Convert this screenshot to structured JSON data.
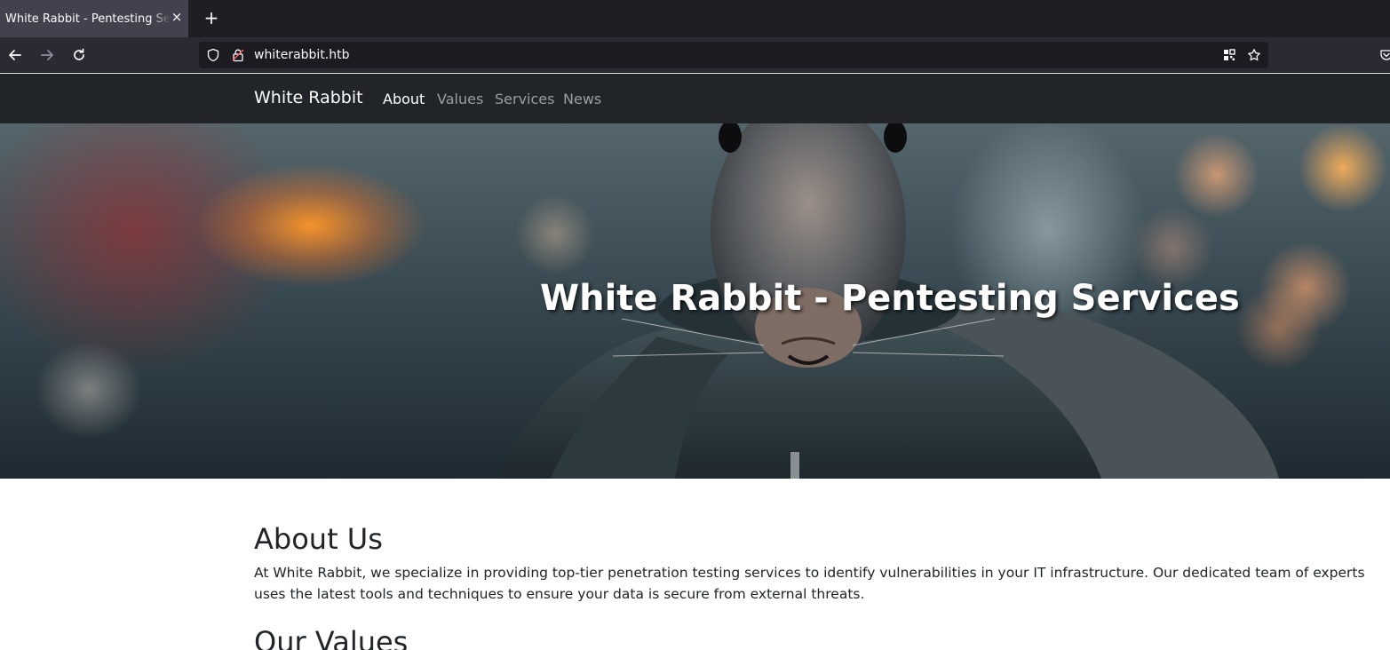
{
  "browser": {
    "tab_title": "White Rabbit - Pentesting Services",
    "tab_close": "×",
    "new_tab": "+",
    "url": "whiterabbit.htb"
  },
  "navbar": {
    "brand": "White Rabbit",
    "links": [
      {
        "label": "About",
        "active": true
      },
      {
        "label": "Values",
        "active": false
      },
      {
        "label": "Services",
        "active": false
      },
      {
        "label": "News",
        "active": false
      }
    ]
  },
  "hero": {
    "title": "White Rabbit - Pentesting Services"
  },
  "sections": [
    {
      "title": "About Us",
      "text": "At White Rabbit, we specialize in providing top-tier penetration testing services to identify vulnerabilities in your IT infrastructure. Our dedicated team of experts uses the latest tools and techniques to ensure your data is secure from external threats."
    },
    {
      "title": "Our Values"
    }
  ],
  "colors": {
    "navbar_bg": "#212529",
    "tab_active_bg": "#42414d",
    "urlbar_bg": "#1c1b22"
  }
}
